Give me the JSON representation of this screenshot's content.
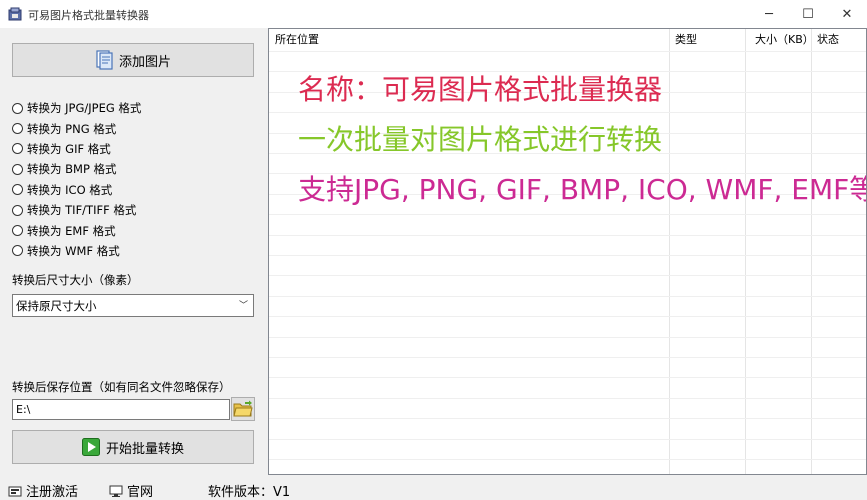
{
  "window": {
    "title": "可易图片格式批量转换器",
    "min_glyph": "─",
    "max_glyph": "☐",
    "close_glyph": "✕"
  },
  "left": {
    "add_button_label": "添加图片",
    "formats": [
      "转换为 JPG/JPEG 格式",
      "转换为 PNG 格式",
      "转换为 GIF 格式",
      "转换为 BMP 格式",
      "转换为 ICO 格式",
      "转换为 TIF/TIFF 格式",
      "转换为 EMF 格式",
      "转换为 WMF 格式"
    ],
    "size_label": "转换后尺寸大小（像素）",
    "size_selected": "保持原尺寸大小",
    "save_label": "转换后保存位置（如有同名文件忽略保存）",
    "save_path": "E:\\",
    "start_button_label": "开始批量转换"
  },
  "list": {
    "columns": [
      "所在位置",
      "类型",
      "大小（KB）",
      "状态"
    ]
  },
  "overlay": {
    "line1": "名称：可易图片格式批量换器",
    "line2": "一次批量对图片格式进行转换",
    "line3": "支持JPG, PNG, GIF, BMP, ICO, WMF, EMF等"
  },
  "status": {
    "register": "注册激活",
    "website": "官网",
    "version": "软件版本：V1"
  },
  "colors": {
    "overlay1": "#dc2b51",
    "overlay2": "#86c72a",
    "overlay3": "#cc2a93"
  }
}
